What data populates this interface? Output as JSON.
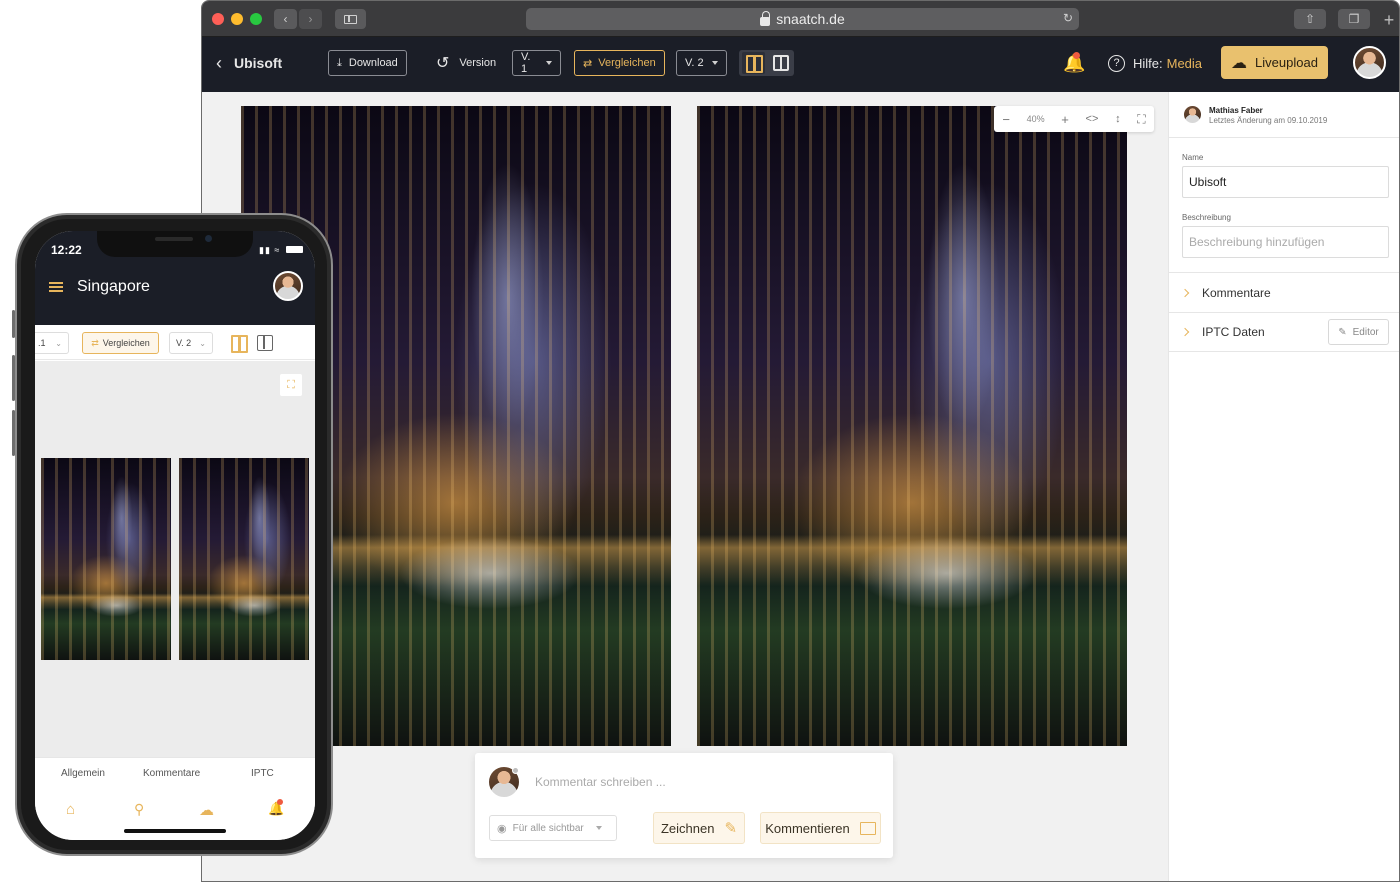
{
  "browser": {
    "url": "snaatch.de"
  },
  "app": {
    "back_label": "Ubisoft",
    "download_label": "Download",
    "version_label": "Version",
    "version_a": "V. 1",
    "compare_label": "Vergleichen",
    "version_b": "V. 2",
    "help_prefix": "Hilfe:",
    "help_link": "Media",
    "liveupload_label": "Liveupload",
    "zoom_level": "40%"
  },
  "comment": {
    "placeholder": "Kommentar schreiben ...",
    "visibility": "Für alle sichtbar",
    "draw_label": "Zeichnen",
    "comment_label": "Kommentieren"
  },
  "sidebar": {
    "author": "Mathias Faber",
    "last_change": "Letztes Änderung am 09.10.2019",
    "name_label": "Name",
    "name_value": "Ubisoft",
    "description_label": "Beschreibung",
    "description_placeholder": "Beschreibung hinzufügen",
    "comments_row": "Kommentare",
    "iptc_row": "IPTC Daten",
    "editor_label": "Editor"
  },
  "phone": {
    "time": "12:22",
    "title": "Singapore",
    "version_a": ".1",
    "compare_label": "Vergleichen",
    "version_b": "V. 2",
    "tabs": [
      "Allgemein",
      "Kommentare",
      "IPTC"
    ]
  },
  "colors": {
    "accent": "#e7b55c",
    "dark": "#1b1e27",
    "liveupload": "#e9c16e",
    "notification": "#ef5a3f"
  }
}
